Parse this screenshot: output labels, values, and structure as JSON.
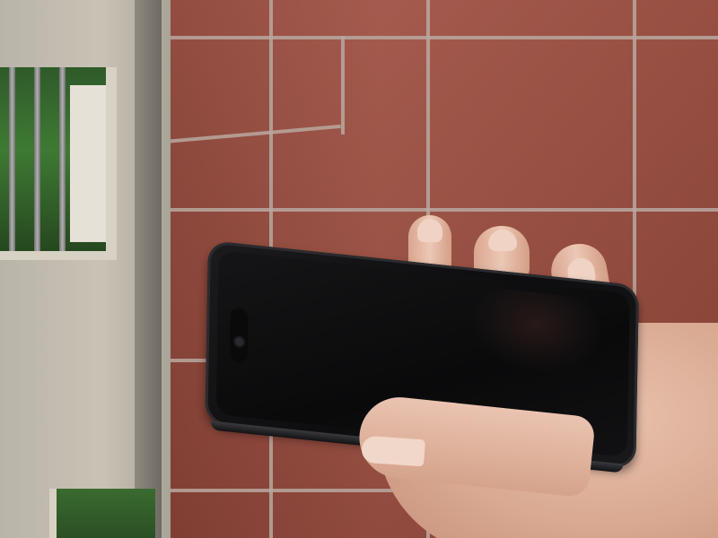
{
  "scene": {
    "colors": {
      "tile": "#9c4b3d",
      "grout": "#b8a8a0",
      "concrete": "#c9c3b6",
      "foliage": "#3e7a33",
      "skin": "#e0b39d",
      "phone_body": "#121214"
    },
    "icons": {
      "front_camera": "front-camera-icon"
    }
  }
}
